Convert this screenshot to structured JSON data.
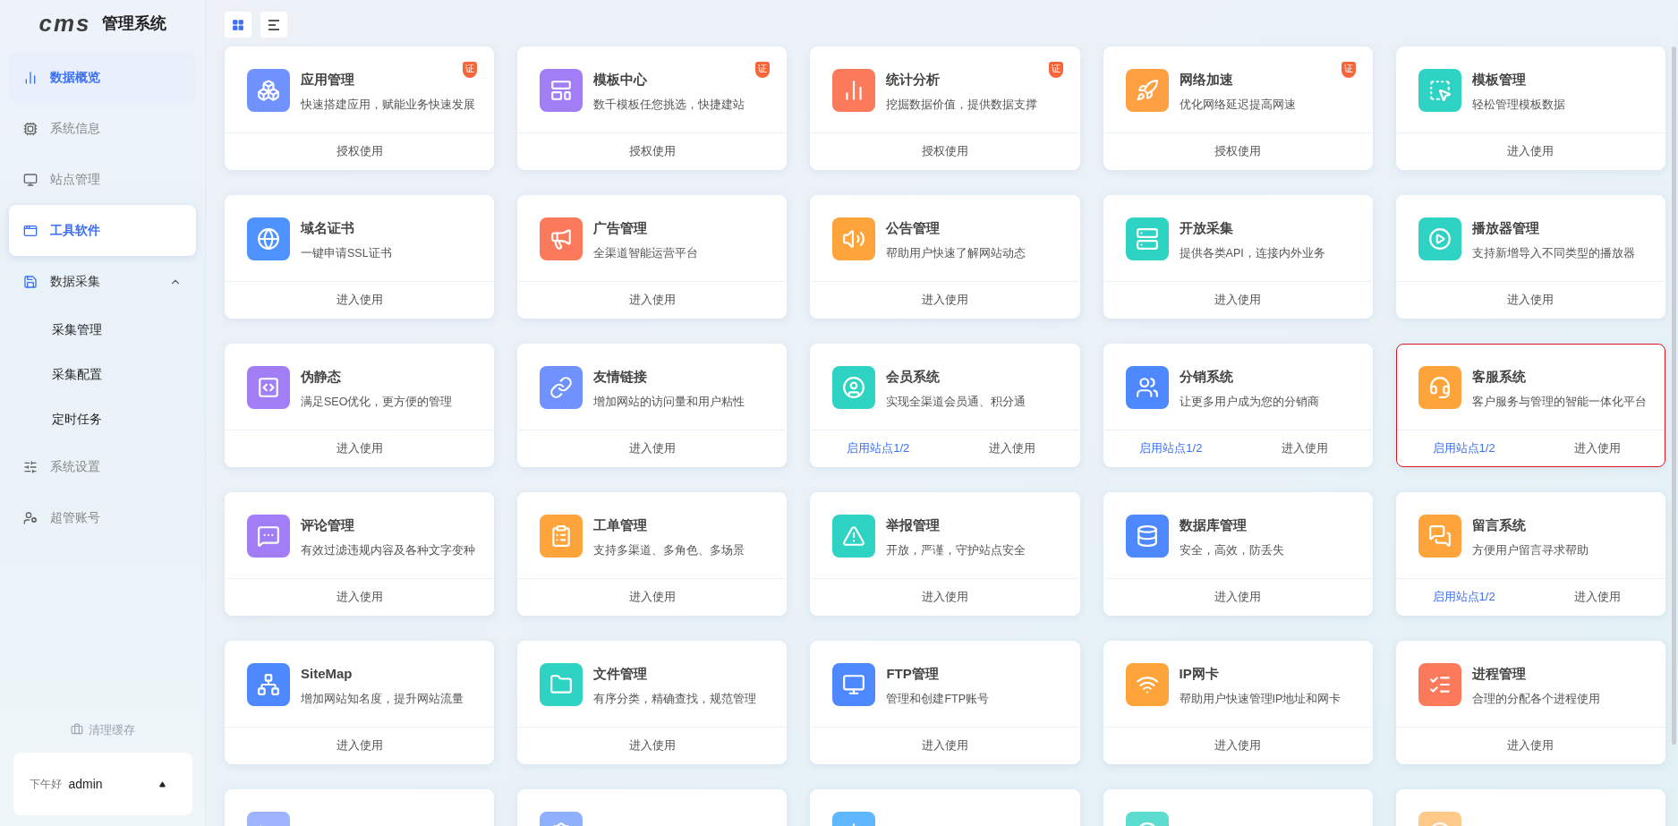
{
  "brand": {
    "logo": "cms",
    "title": "管理系统"
  },
  "sidebar": {
    "items": [
      {
        "label": "数据概览",
        "active": true,
        "selected": false
      },
      {
        "label": "系统信息",
        "active": false,
        "selected": false
      },
      {
        "label": "站点管理",
        "active": false,
        "selected": false
      },
      {
        "label": "工具软件",
        "active": true,
        "selected": true
      },
      {
        "label": "数据采集",
        "active": false,
        "selected": false,
        "expanded": true,
        "children": [
          {
            "label": "采集管理"
          },
          {
            "label": "采集配置"
          },
          {
            "label": "定时任务"
          }
        ]
      },
      {
        "label": "系统设置",
        "active": false,
        "selected": false
      },
      {
        "label": "超管账号",
        "active": false,
        "selected": false
      }
    ],
    "clear_cache": "清理缓存",
    "user": {
      "greeting": "下午好",
      "name": "admin"
    }
  },
  "view_toggle": [
    {
      "kind": "grid",
      "selected": true
    },
    {
      "kind": "list",
      "selected": false
    }
  ],
  "cards": [
    {
      "title": "应用管理",
      "desc": "快速搭建应用，赋能业务快速发展",
      "badge": "证",
      "action": "授权使用",
      "color": "#6f92ff",
      "highlighted": false
    },
    {
      "title": "模板中心",
      "desc": "数千模板任您挑选，快捷建站",
      "badge": "证",
      "action": "授权使用",
      "color": "#a17df6",
      "highlighted": false
    },
    {
      "title": "统计分析",
      "desc": "挖掘数据价值，提供数据支撑",
      "badge": "证",
      "action": "授权使用",
      "color": "#fb7a5c",
      "highlighted": false
    },
    {
      "title": "网络加速",
      "desc": "优化网络延迟提高网速",
      "badge": "证",
      "action": "授权使用",
      "color": "#ffa043",
      "highlighted": false
    },
    {
      "title": "模板管理",
      "desc": "轻松管理模板数据",
      "action": "进入使用",
      "color": "#2fd3c4",
      "highlighted": false
    },
    {
      "title": "域名证书",
      "desc": "一键申请SSL证书",
      "action": "进入使用",
      "color": "#4e92ff",
      "highlighted": false
    },
    {
      "title": "广告管理",
      "desc": "全渠道智能运营平台",
      "action": "进入使用",
      "color": "#fb7a5c",
      "highlighted": false
    },
    {
      "title": "公告管理",
      "desc": "帮助用户快速了解网站动态",
      "action": "进入使用",
      "color": "#ffa43b",
      "highlighted": false
    },
    {
      "title": "开放采集",
      "desc": "提供各类API，连接内外业务",
      "action": "进入使用",
      "color": "#2fd3c4",
      "highlighted": false
    },
    {
      "title": "播放器管理",
      "desc": "支持新增导入不同类型的播放器",
      "action": "进入使用",
      "color": "#2fd3c4",
      "highlighted": false
    },
    {
      "title": "伪静态",
      "desc": "满足SEO优化，更方便的管理",
      "action": "进入使用",
      "color": "#a17df6",
      "highlighted": false
    },
    {
      "title": "友情链接",
      "desc": "增加网站的访问量和用户粘性",
      "action": "进入使用",
      "color": "#6f92ff",
      "highlighted": false
    },
    {
      "title": "会员系统",
      "desc": "实现全渠道会员通、积分通",
      "site_link": "启用站点1/2",
      "action": "进入使用",
      "color": "#2fd3c4",
      "highlighted": false
    },
    {
      "title": "分销系统",
      "desc": "让更多用户成为您的分销商",
      "site_link": "启用站点1/2",
      "action": "进入使用",
      "color": "#4e88ff",
      "highlighted": false
    },
    {
      "title": "客服系统",
      "desc": "客户服务与管理的智能一体化平台",
      "site_link": "启用站点1/2",
      "action": "进入使用",
      "color": "#ffa43b",
      "highlighted": true
    },
    {
      "title": "评论管理",
      "desc": "有效过滤违规内容及各种文字变种",
      "action": "进入使用",
      "color": "#a17df6",
      "highlighted": false
    },
    {
      "title": "工单管理",
      "desc": "支持多渠道、多角色、多场景",
      "action": "进入使用",
      "color": "#ffa43b",
      "highlighted": false
    },
    {
      "title": "举报管理",
      "desc": "开放，严谨，守护站点安全",
      "action": "进入使用",
      "color": "#2fd3c4",
      "highlighted": false
    },
    {
      "title": "数据库管理",
      "desc": "安全，高效，防丢失",
      "action": "进入使用",
      "color": "#4e88ff",
      "highlighted": false
    },
    {
      "title": "留言系统",
      "desc": "方便用户留言寻求帮助",
      "site_link": "启用站点1/2",
      "action": "进入使用",
      "color": "#ffa43b",
      "highlighted": false
    },
    {
      "title": "SiteMap",
      "desc": "增加网站知名度，提升网站流量",
      "action": "进入使用",
      "color": "#4e88ff",
      "highlighted": false
    },
    {
      "title": "文件管理",
      "desc": "有序分类，精确查找，规范管理",
      "action": "进入使用",
      "color": "#2fd3c4",
      "highlighted": false
    },
    {
      "title": "FTP管理",
      "desc": "管理和创建FTP账号",
      "action": "进入使用",
      "color": "#4e88ff",
      "highlighted": false
    },
    {
      "title": "IP网卡",
      "desc": "帮助用户快速管理IP地址和网卡",
      "action": "进入使用",
      "color": "#ffa43b",
      "highlighted": false
    },
    {
      "title": "进程管理",
      "desc": "合理的分配各个进程使用",
      "action": "进入使用",
      "color": "#fb7a5c",
      "highlighted": false
    },
    {
      "color": "#9fb4ff",
      "highlighted": false
    },
    {
      "color": "#8fb0ff",
      "highlighted": false
    },
    {
      "color": "#5fb8ff",
      "highlighted": false
    },
    {
      "color": "#5ddcd0",
      "highlighted": false
    },
    {
      "color": "#ffc98a",
      "highlighted": false
    }
  ]
}
